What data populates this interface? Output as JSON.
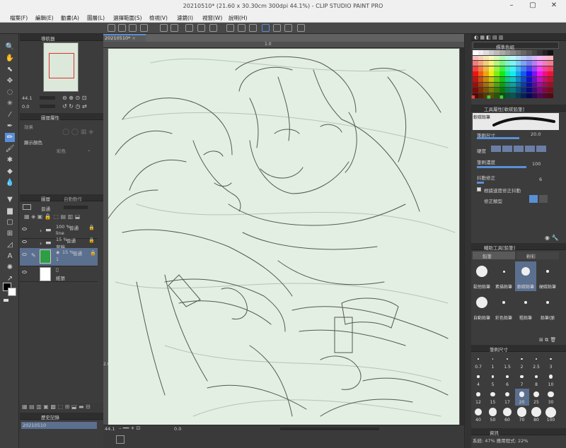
{
  "window": {
    "title": "20210510* (21.60 x 30.30cm 300dpi 44.1%) - CLIP STUDIO PAINT PRO"
  },
  "menu": [
    "檔案(F)",
    "編輯(E)",
    "動畫(A)",
    "圖層(L)",
    "選擇範圍(S)",
    "檢視(V)",
    "濾鏡(I)",
    "視窗(W)",
    "說明(H)"
  ],
  "navigator": {
    "title": "導航器",
    "zoom": "44.1",
    "angle": "0.0"
  },
  "tool_property": {
    "title": "圖層屬性",
    "effect_label": "效果",
    "color_label": "顯示顏色",
    "color_value": "彩色"
  },
  "layers": {
    "tabs": [
      "圖層",
      "自動動作"
    ],
    "blend_mode": "普通",
    "rows": [
      {
        "opacity": "100 %",
        "mode": "普通",
        "name": "line",
        "type": "folder"
      },
      {
        "opacity": "15 %",
        "mode": "普通",
        "name": "草稿",
        "type": "folder"
      },
      {
        "opacity": "15 %",
        "mode": "普通",
        "name": "1",
        "type": "layer",
        "selected": true
      },
      {
        "opacity": "",
        "mode": "",
        "name": "紙張",
        "type": "paper"
      }
    ]
  },
  "history": {
    "title": "歷史記錄",
    "item": "20210510"
  },
  "canvas": {
    "tab_label": "20210510*",
    "ruler_top": "1.0",
    "ruler_left": "2.0"
  },
  "status": {
    "zoom": "44.1",
    "angle": "0.0"
  },
  "color_set": {
    "title": "標準色組"
  },
  "sub_tool_detail": {
    "title": "工具屬性[軟碳鉛筆]",
    "brush_name": "軟碳鉛筆",
    "size_label": "筆刷尺寸",
    "size_value": "20.0",
    "hardness_label": "硬度",
    "density_label": "筆刷濃度",
    "density_value": "100",
    "stabilization_label": "抖動修正",
    "stabilization_value": "6",
    "speed_label": "根據速度修正抖動",
    "correction_label": "修正類型"
  },
  "sub_tool": {
    "title": "輔助工具[鉛筆]",
    "tabs": [
      "鉛筆",
      "粉彩"
    ],
    "brushes": [
      {
        "name": "鬆弛鉛筆"
      },
      {
        "name": "素描鉛筆"
      },
      {
        "name": "軟碳鉛筆",
        "selected": true
      },
      {
        "name": "硬碳鉛筆"
      },
      {
        "name": "自動鉛筆"
      },
      {
        "name": "彩色鉛筆"
      },
      {
        "name": "粗鉛筆"
      },
      {
        "name": "鉛筆(脈"
      }
    ]
  },
  "brush_size": {
    "title": "筆刷尺寸",
    "sizes": [
      "0.7",
      "1",
      "1.5",
      "2",
      "2.5",
      "3",
      "4",
      "5",
      "6",
      "7",
      "8",
      "10",
      "12",
      "15",
      "17",
      "20",
      "25",
      "30",
      "40",
      "50",
      "60",
      "70",
      "80",
      "100"
    ]
  },
  "info": {
    "title": "資訊",
    "line": "系統: 47%   應用程式: 22%"
  },
  "colors": {
    "accent": "#4a86d8",
    "panel_bg": "#3c3c3c",
    "paper": "#e3efe2",
    "layer_color": "#2e9e44"
  }
}
